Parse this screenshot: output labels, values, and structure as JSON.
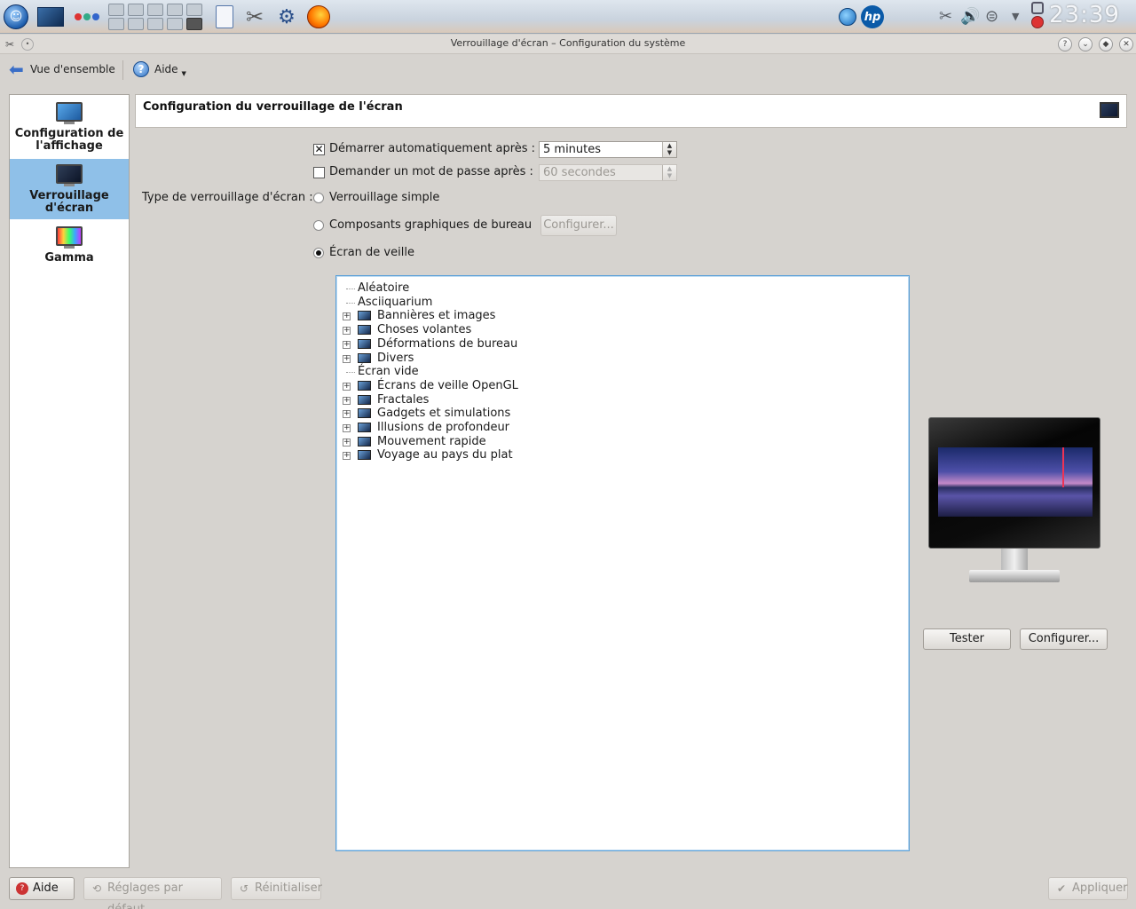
{
  "taskbar": {
    "clock": "23:39",
    "pager_cells": 10
  },
  "window": {
    "title": "Verrouillage d'écran – Configuration du système"
  },
  "toolbar": {
    "overview_label": "Vue d'ensemble",
    "help_label": "Aide"
  },
  "sidebar": {
    "items": [
      {
        "label": "Configuration de l'affichage",
        "icon": "monitor-icon"
      },
      {
        "label": "Verrouillage d'écran",
        "icon": "screen-lock-icon"
      },
      {
        "label": "Gamma",
        "icon": "gamma-icon"
      }
    ]
  },
  "main": {
    "title": "Configuration du verrouillage de l'écran",
    "auto_start": {
      "label": "Démarrer automatiquement après :",
      "checked": true,
      "value": "5 minutes"
    },
    "password": {
      "label": "Demander un mot de passe après :",
      "checked": false,
      "value": "60 secondes"
    },
    "lock_type_label": "Type de verrouillage d'écran :",
    "options": {
      "simple": "Verrouillage simple",
      "widgets": "Composants graphiques de bureau",
      "screensaver": "Écran de veille"
    },
    "widgets_configure": "Configurer...",
    "tree": [
      {
        "label": "Aléatoire",
        "expandable": false
      },
      {
        "label": "Asciiquarium",
        "expandable": false
      },
      {
        "label": "Bannières et images",
        "expandable": true
      },
      {
        "label": "Choses volantes",
        "expandable": true
      },
      {
        "label": "Déformations de bureau",
        "expandable": true
      },
      {
        "label": "Divers",
        "expandable": true
      },
      {
        "label": "Écran vide",
        "expandable": false
      },
      {
        "label": "Écrans de veille OpenGL",
        "expandable": true
      },
      {
        "label": "Fractales",
        "expandable": true
      },
      {
        "label": "Gadgets et simulations",
        "expandable": true
      },
      {
        "label": "Illusions de profondeur",
        "expandable": true
      },
      {
        "label": "Mouvement rapide",
        "expandable": true
      },
      {
        "label": "Voyage au pays du plat",
        "expandable": true
      }
    ],
    "test_label": "Tester",
    "configure_label": "Configurer..."
  },
  "footer": {
    "help": "Aide",
    "defaults": "Réglages par défaut",
    "reset": "Réinitialiser",
    "apply": "Appliquer"
  },
  "colors": {
    "selection": "#8fc0e8",
    "focus_border": "#5aa0d8"
  }
}
